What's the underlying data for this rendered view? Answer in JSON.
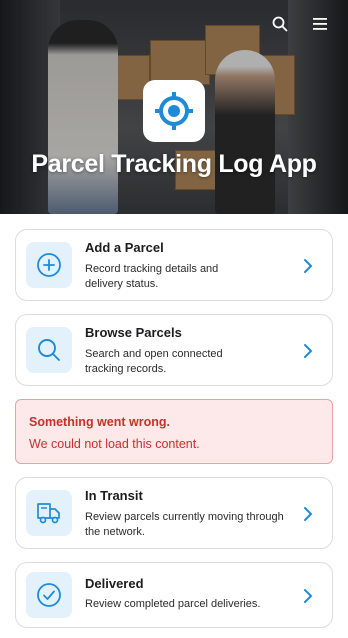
{
  "header": {
    "title": "Parcel Tracking Log App",
    "search_icon": "search-icon",
    "menu_icon": "menu-icon",
    "logo_icon": "target-icon"
  },
  "colors": {
    "accent": "#1f8ad6",
    "tile_background": "#e3f1fa",
    "error_text": "#c4322c",
    "error_background": "#fde9e9"
  },
  "cards": [
    {
      "title": "Add a Parcel",
      "description_line1": "Record tracking details and",
      "description_line2": "delivery status.",
      "icon": "plus-circle-icon"
    },
    {
      "title": "Browse Parcels",
      "description_line1": "Search and open connected",
      "description_line2": "tracking records.",
      "icon": "search-icon"
    },
    {
      "title": "In Transit",
      "description_line1": "Review parcels currently moving through",
      "description_line2": "the network.",
      "icon": "truck-icon"
    },
    {
      "title": "Delivered",
      "description_line1": "Review completed parcel deliveries.",
      "description_line2": "",
      "icon": "check-circle-icon"
    }
  ],
  "error": {
    "title": "Something went wrong.",
    "message": "We could not load this content."
  }
}
